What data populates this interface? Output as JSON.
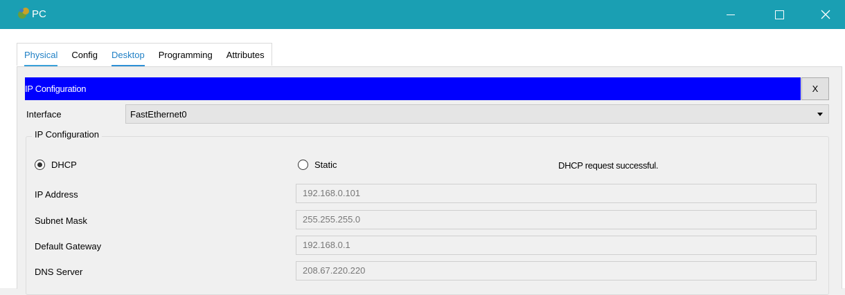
{
  "window": {
    "title": "PC",
    "icon": "pc-app-icon",
    "accent": "#1a9fb3"
  },
  "tabs": [
    "Physical",
    "Config",
    "Desktop",
    "Programming",
    "Attributes"
  ],
  "ip_config": {
    "header": "IP Configuration",
    "header_color": "#0000ff",
    "close_label": "X",
    "interface_label": "Interface",
    "interface_value": "FastEthernet0",
    "group_label": "IP Configuration",
    "dhcp_label": "DHCP",
    "static_label": "Static",
    "mode_selected": "DHCP",
    "status": "DHCP request successful.",
    "fields": [
      {
        "label": "IP Address",
        "value": "192.168.0.101"
      },
      {
        "label": "Subnet Mask",
        "value": "255.255.255.0"
      },
      {
        "label": "Default Gateway",
        "value": "192.168.0.1"
      },
      {
        "label": "DNS Server",
        "value": "208.67.220.220"
      }
    ]
  }
}
